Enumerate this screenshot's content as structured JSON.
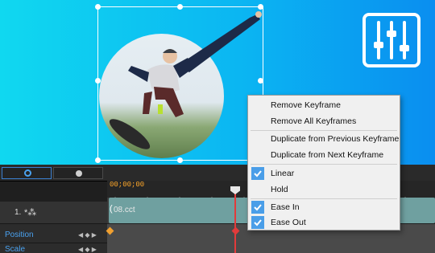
{
  "context_menu": {
    "items": [
      {
        "label": "Remove Keyframe",
        "checked": false
      },
      {
        "label": "Remove All Keyframes",
        "checked": false
      },
      {
        "label": "Duplicate from Previous Keyframe",
        "checked": false
      },
      {
        "label": "Duplicate from Next Keyframe",
        "checked": false
      },
      {
        "label": "Linear",
        "checked": true
      },
      {
        "label": "Hold",
        "checked": false
      },
      {
        "label": "Ease In",
        "checked": true
      },
      {
        "label": "Ease Out",
        "checked": true
      }
    ]
  },
  "timeline": {
    "timecode": "00;00;00",
    "track_number": "1.",
    "clip_label": "08.cct",
    "properties": [
      "Position",
      "Scale"
    ]
  },
  "colors": {
    "accent": "#4a9ee8",
    "playhead": "#e23b3b",
    "timecode": "#ffa82a",
    "property_label": "#4aa2f0"
  },
  "icons": {
    "settings": "sliders-icon",
    "check": "checkmark-icon"
  }
}
